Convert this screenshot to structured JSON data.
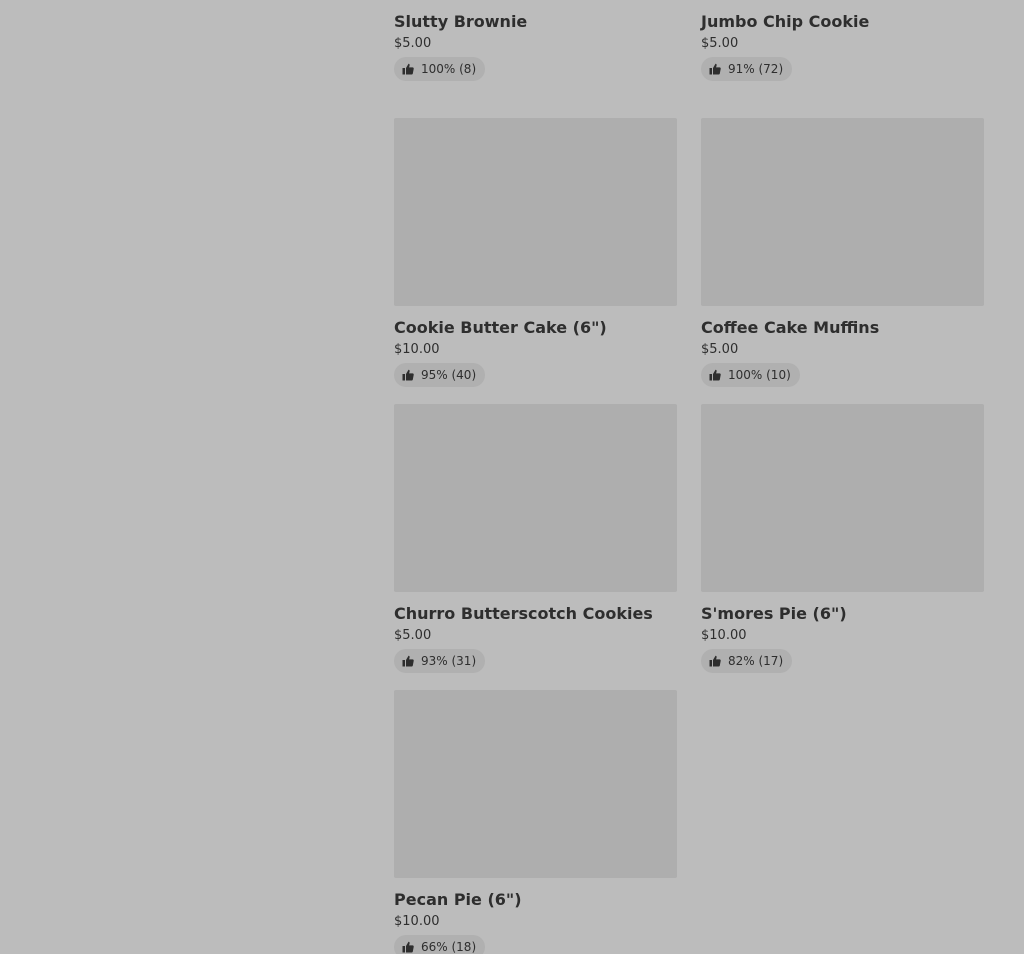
{
  "menu": {
    "items": [
      {
        "name": "Slutty Brownie",
        "price": "$5.00",
        "rating": "100% (8)",
        "image": "brownie"
      },
      {
        "name": "Jumbo Chip Cookie",
        "price": "$5.00",
        "rating": "91% (72)",
        "image": "cookie"
      },
      {
        "name": "Cookie Butter Cake (6\")",
        "price": "$10.00",
        "rating": "95% (40)",
        "image": "placeholder"
      },
      {
        "name": "Coffee Cake Muffins",
        "price": "$5.00",
        "rating": "100% (10)",
        "image": "placeholder"
      },
      {
        "name": "Churro Butterscotch Cookies",
        "price": "$5.00",
        "rating": "93% (31)",
        "image": "placeholder"
      },
      {
        "name": "S'mores Pie (6\")",
        "price": "$10.00",
        "rating": "82% (17)",
        "image": "placeholder"
      },
      {
        "name": "Pecan Pie (6\")",
        "price": "$10.00",
        "rating": "66% (18)",
        "image": "placeholder"
      }
    ],
    "rating_icon": "thumbs-up-icon"
  },
  "colors": {
    "overlay_background": "#bcbcbc",
    "image_placeholder": "#aeaeae",
    "text": "#2e2e2e",
    "rating_pill": "#b0b0b0"
  }
}
